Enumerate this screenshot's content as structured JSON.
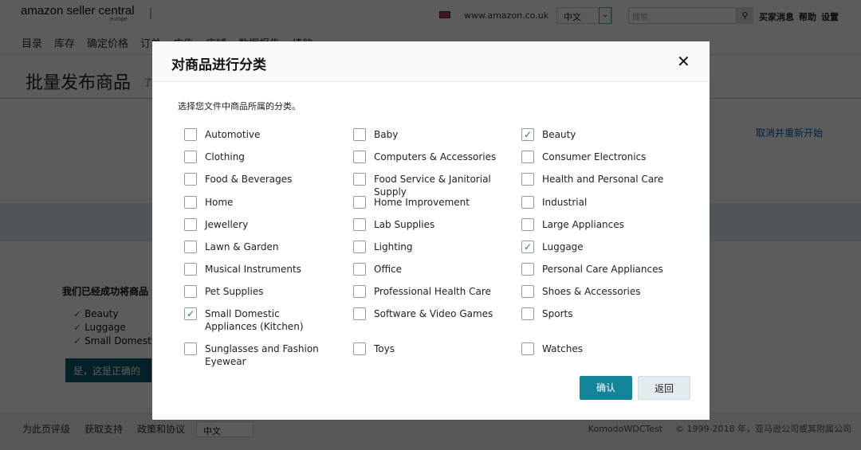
{
  "header": {
    "logo": "amazon seller central",
    "logo_region": "europe",
    "site": "www.amazon.co.uk",
    "language": "中文",
    "search_placeholder": "搜索",
    "links": [
      "买家消息",
      "帮助",
      "设置"
    ]
  },
  "nav": [
    "目录",
    "库存",
    "确定价格",
    "订单",
    "广告",
    "店铺",
    "数据报告",
    "绩效"
  ],
  "page": {
    "title": "批量发布商品",
    "title_link": "了",
    "cancel": "取消并重新开始",
    "done_text": "我们已经成功将商品",
    "done_items": [
      "Beauty",
      "Luggage",
      "Small Domestic"
    ],
    "yes_button": "是，这是正确的"
  },
  "footer": {
    "links": [
      "为此页评级",
      "获取支持",
      "政策和协议"
    ],
    "language": "中文",
    "account": "KomodoWDCTest",
    "copyright": "© 1999-2018 年，亚马逊公司或其附属公司"
  },
  "modal": {
    "title": "对商品进行分类",
    "instruction": "选择您文件中商品所属的分类。",
    "confirm": "确认",
    "back": "返回",
    "categories": [
      {
        "label": "Automotive",
        "checked": false
      },
      {
        "label": "Baby",
        "checked": false
      },
      {
        "label": "Beauty",
        "checked": true
      },
      {
        "label": "Clothing",
        "checked": false
      },
      {
        "label": "Computers & Accessories",
        "checked": false
      },
      {
        "label": "Consumer Electronics",
        "checked": false
      },
      {
        "label": "Food & Beverages",
        "checked": false
      },
      {
        "label": "Food Service & Janitorial Supply",
        "checked": false
      },
      {
        "label": "Health and Personal Care",
        "checked": false
      },
      {
        "label": "Home",
        "checked": false
      },
      {
        "label": "Home Improvement",
        "checked": false
      },
      {
        "label": "Industrial",
        "checked": false
      },
      {
        "label": "Jewellery",
        "checked": false
      },
      {
        "label": "Lab Supplies",
        "checked": false
      },
      {
        "label": "Large Appliances",
        "checked": false
      },
      {
        "label": "Lawn & Garden",
        "checked": false
      },
      {
        "label": "Lighting",
        "checked": false
      },
      {
        "label": "Luggage",
        "checked": true
      },
      {
        "label": "Musical Instruments",
        "checked": false
      },
      {
        "label": "Office",
        "checked": false
      },
      {
        "label": "Personal Care Appliances",
        "checked": false
      },
      {
        "label": "Pet Supplies",
        "checked": false
      },
      {
        "label": "Professional Health Care",
        "checked": false
      },
      {
        "label": "Shoes & Accessories",
        "checked": false
      },
      {
        "label": "Small Domestic Appliances (Kitchen)",
        "checked": true
      },
      {
        "label": "Software & Video Games",
        "checked": false
      },
      {
        "label": "Sports",
        "checked": false
      },
      {
        "label": "Sunglasses and Fashion Eyewear",
        "checked": false
      },
      {
        "label": "Toys",
        "checked": false
      },
      {
        "label": "Watches",
        "checked": false
      }
    ]
  },
  "colors": {
    "accent": "#12849a",
    "check": "#0e7a90"
  }
}
